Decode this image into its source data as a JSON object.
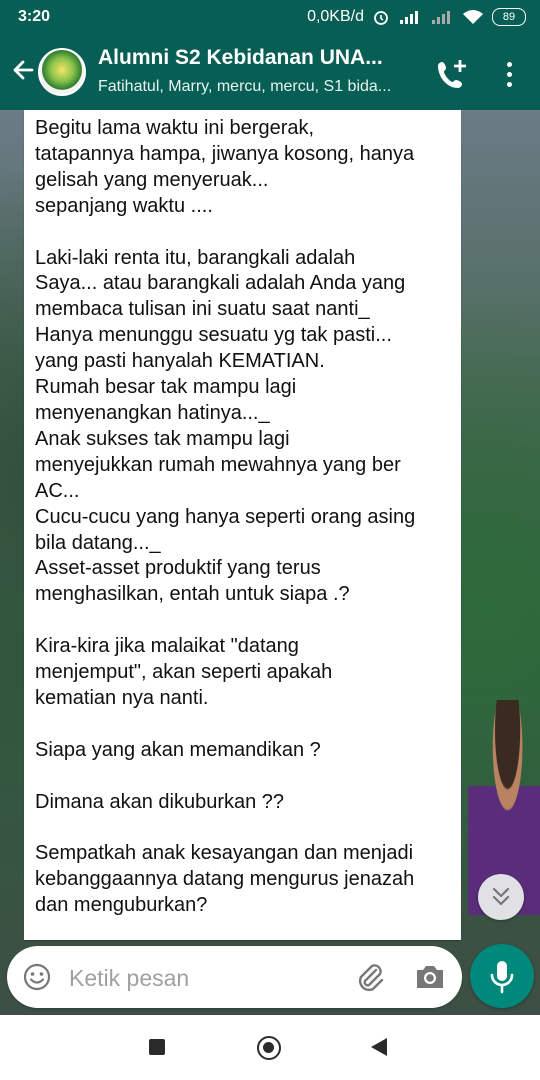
{
  "status_bar": {
    "time": "3:20",
    "net_speed": "0,0KB/d",
    "battery": "89"
  },
  "header": {
    "title": "Alumni S2 Kebidanan UNA...",
    "subtitle": "Fatihatul, Marry, mercu, mercu, S1 bida..."
  },
  "message": {
    "text": "Begitu lama waktu ini bergerak,\ntatapannya hampa, jiwanya kosong, hanya\ngelisah yang menyeruak...\nsepanjang waktu ....\n\nLaki-laki renta itu, barangkali adalah\nSaya... atau barangkali adalah Anda yang\nmembaca tulisan ini suatu saat nanti_\nHanya menunggu sesuatu yg tak pasti...\nyang pasti hanyalah KEMATIAN.\nRumah besar tak mampu lagi\nmenyenangkan hatinya..._\nAnak sukses tak mampu lagi\nmenyejukkan rumah mewahnya yang ber\nAC...\nCucu-cucu yang hanya seperti orang asing\nbila datang..._\nAsset-asset produktif yang terus\nmenghasilkan, entah untuk siapa .?\n\nKira-kira jika malaikat \"datang\nmenjemput\", akan seperti apakah\nkematian nya nanti.\n\nSiapa yang akan memandikan ?\n\nDimana akan dikuburkan ??\n\nSempatkah anak kesayangan dan menjadi\nkebanggaannya datang mengurus jenazah\ndan menguburkan?"
  },
  "composer": {
    "placeholder": "Ketik pesan"
  },
  "colors": {
    "header": "#075e54",
    "mic_button": "#00897b",
    "bubble": "#ffffff"
  },
  "icons": {
    "back": "back-arrow-icon",
    "call": "add-call-icon",
    "menu": "more-vert-icon",
    "emoji": "emoji-icon",
    "attach": "paperclip-icon",
    "camera": "camera-icon",
    "mic": "mic-icon",
    "scroll": "double-chevron-down-icon"
  }
}
